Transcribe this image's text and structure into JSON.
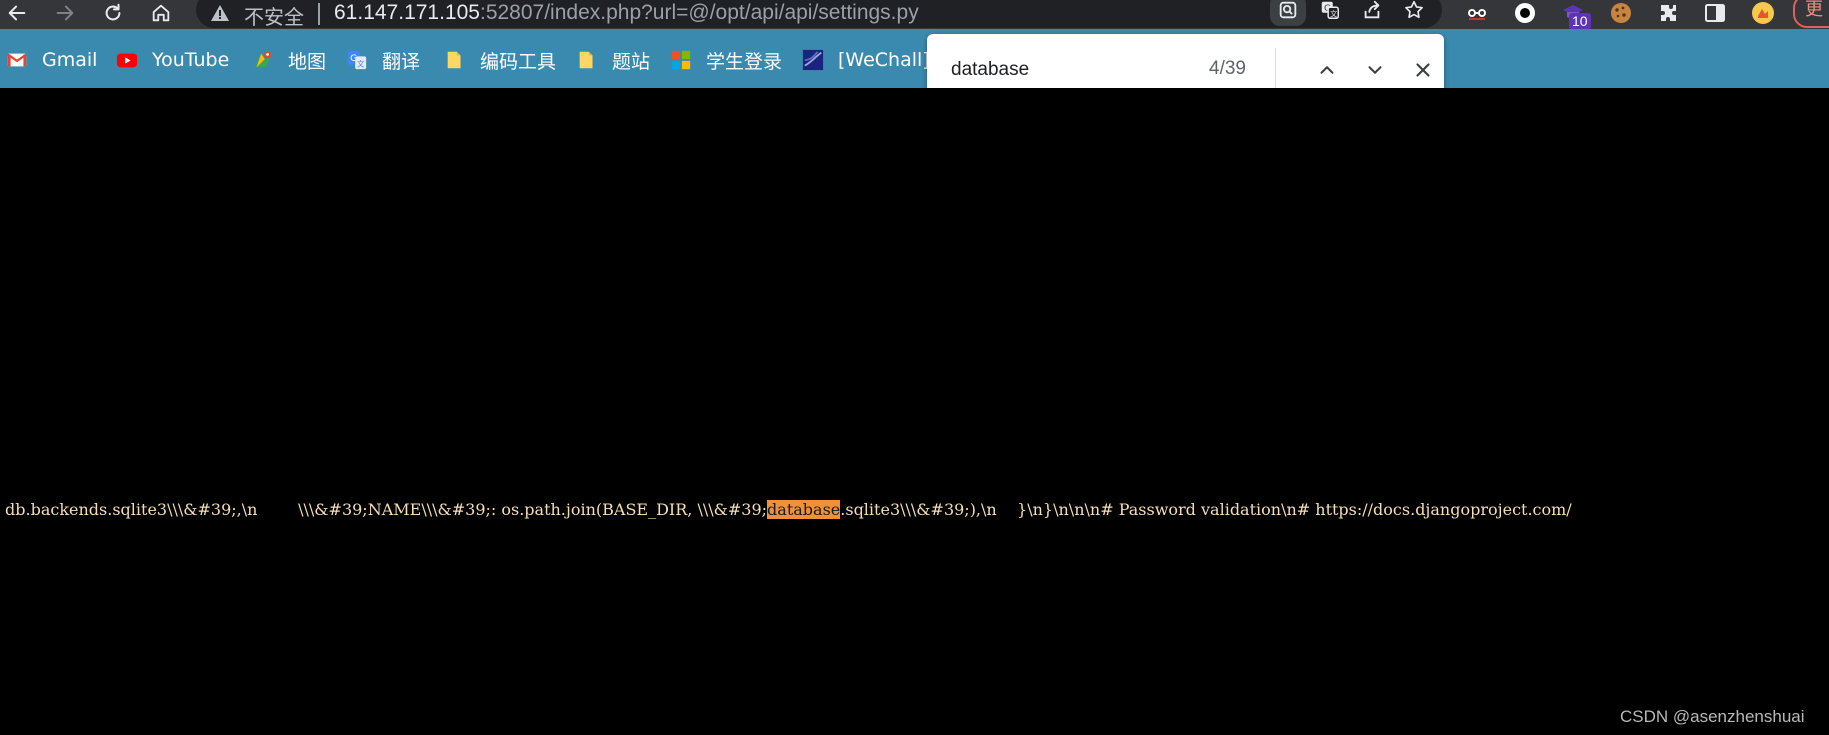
{
  "browser": {
    "omnibox": {
      "insecure_label": "不安全",
      "url_host": "61.147.171.105",
      "url_path": ":52807/index.php?url=@/opt/api/api/settings.py"
    },
    "extension_badge": "10",
    "profile_label": "更"
  },
  "bookmarks": [
    {
      "label": "Gmail",
      "icon": "gmail-icon"
    },
    {
      "label": "YouTube",
      "icon": "youtube-icon"
    },
    {
      "label": "地图",
      "icon": "maps-icon"
    },
    {
      "label": "翻译",
      "icon": "translate-icon"
    },
    {
      "label": "编码工具",
      "icon": "folder-icon"
    },
    {
      "label": "题站",
      "icon": "folder-icon"
    },
    {
      "label": "学生登录",
      "icon": "windows-icon"
    },
    {
      "label": "[WeChall] (",
      "icon": "wechall-icon"
    }
  ],
  "find_bar": {
    "query": "database",
    "count": "4/39"
  },
  "page": {
    "code_before": "db.backends.sqlite3\\\\\\&#39;,\\n        \\\\\\&#39;NAME\\\\\\&#39;: os.path.join(BASE_DIR, \\\\\\&#39;",
    "code_match": "database",
    "code_after": ".sqlite3\\\\\\&#39;),\\n    }\\n}\\n\\n\\n# Password validation\\n# https://docs.djangoproject.com/",
    "watermark": "CSDN @asenzhenshuai"
  },
  "colors": {
    "toolbar_bg": "#35363a",
    "bookmarks_bg": "#3a8ab0",
    "page_bg": "#000000",
    "code_text": "#f5deb3",
    "match_highlight": "#f0913a"
  }
}
